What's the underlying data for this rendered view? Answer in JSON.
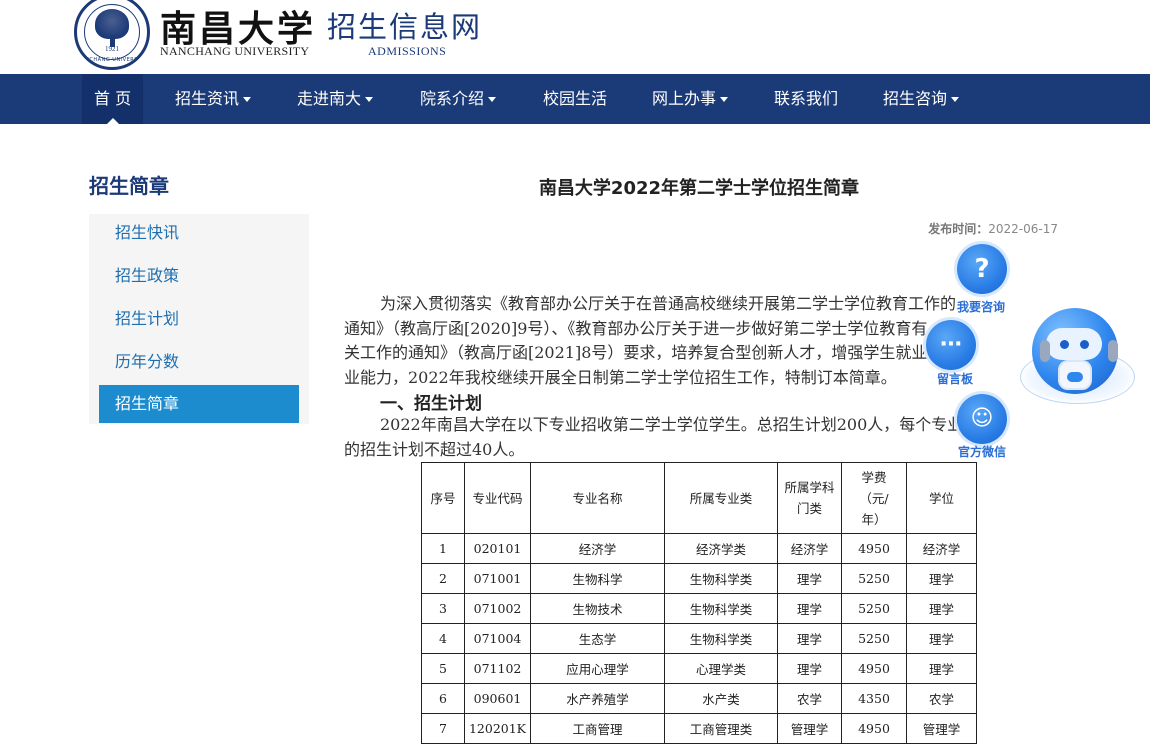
{
  "header": {
    "logo_cn": "南昌大学",
    "logo_en": "NANCHANG UNIVERSITY",
    "site_cn": "招生信息网",
    "site_en": "ADMISSIONS",
    "seal_year": "1921",
    "seal_text": "NANCHANG UNIVERSITY"
  },
  "nav": {
    "items": [
      {
        "label": "首 页",
        "dropdown": false,
        "active": true
      },
      {
        "label": "招生资讯",
        "dropdown": true
      },
      {
        "label": "走进南大",
        "dropdown": true
      },
      {
        "label": "院系介绍",
        "dropdown": true
      },
      {
        "label": "校园生活",
        "dropdown": false
      },
      {
        "label": "网上办事",
        "dropdown": true
      },
      {
        "label": "联系我们",
        "dropdown": false
      },
      {
        "label": "招生咨询",
        "dropdown": true
      }
    ]
  },
  "sidebar": {
    "title": "招生简章",
    "items": [
      {
        "label": "招生快讯"
      },
      {
        "label": "招生政策"
      },
      {
        "label": "招生计划"
      },
      {
        "label": "历年分数"
      },
      {
        "label": "招生简章",
        "active": true
      }
    ]
  },
  "article": {
    "title": "南昌大学2022年第二学士学位招生简章",
    "publish_label": "发布时间：",
    "publish_date": "2022-06-17",
    "intro_lines": [
      "为深入贯彻落实《教育部办公厅关于在普通高校继续开展第二学士学位教育工作的",
      "通知》（教高厅函[2020]9号）、《教育部办公厅关于进一步做好第二学士学位教育有",
      "关工作的通知》（教高厅函[2021]8号）要求，培养复合型创新人才，增强学生就业创",
      "业能力，2022年我校继续开展全日制第二学士学位招生工作，特制订本简章。"
    ],
    "section1_title": "一、招生计划",
    "section1_lines": [
      "2022年南昌大学在以下专业招收第二学士学位学生。总招生计划200人，每个专业",
      "的招生计划不超过40人。"
    ]
  },
  "table": {
    "headers": [
      "序号",
      "专业代码",
      "专业名称",
      "所属专业类",
      "所属学科门类",
      "学费（元/年）",
      "学位"
    ],
    "header_lines": [
      [
        "序号"
      ],
      [
        "专业代码"
      ],
      [
        "专业名称"
      ],
      [
        "所属专业类"
      ],
      [
        "所属学科",
        "门类"
      ],
      [
        "学费",
        "（元/",
        "年）"
      ],
      [
        "学位"
      ]
    ],
    "rows": [
      [
        "1",
        "020101",
        "经济学",
        "经济学类",
        "经济学",
        "4950",
        "经济学"
      ],
      [
        "2",
        "071001",
        "生物科学",
        "生物科学类",
        "理学",
        "5250",
        "理学"
      ],
      [
        "3",
        "071002",
        "生物技术",
        "生物科学类",
        "理学",
        "5250",
        "理学"
      ],
      [
        "4",
        "071004",
        "生态学",
        "生物科学类",
        "理学",
        "5250",
        "理学"
      ],
      [
        "5",
        "071102",
        "应用心理学",
        "心理学类",
        "理学",
        "4950",
        "理学"
      ],
      [
        "6",
        "090601",
        "水产养殖学",
        "水产类",
        "农学",
        "4350",
        "农学"
      ],
      [
        "7",
        "120201K",
        "工商管理",
        "工商管理类",
        "管理学",
        "4950",
        "管理学"
      ]
    ]
  },
  "floating": {
    "buttons": [
      {
        "label": "我要咨询",
        "icon": "question-icon"
      },
      {
        "label": "留言板",
        "icon": "chat-bubble-icon"
      },
      {
        "label": "官方微信",
        "icon": "wechat-icon"
      }
    ]
  },
  "colors": {
    "nav_bg": "#1b3a78",
    "active_side": "#1d8ccf",
    "side_link": "#1f6fb0",
    "float_blue": "#2a7de6"
  }
}
